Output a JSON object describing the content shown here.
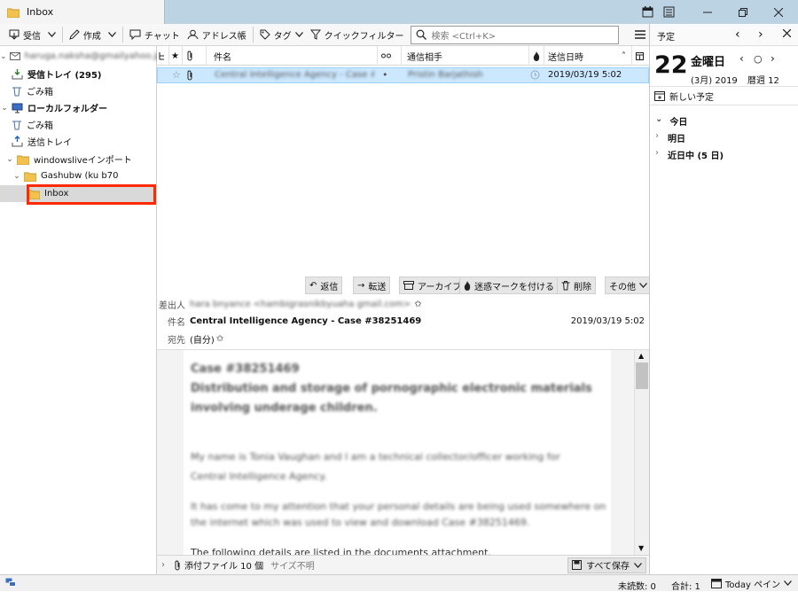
{
  "window": {
    "tab_title": "Inbox"
  },
  "toolbar": {
    "receive": "受信",
    "compose": "作成",
    "chat": "チャット",
    "address_book": "アドレス帳",
    "tag": "タグ",
    "quick_filter": "クイックフィルター",
    "search_placeholder": "検索 <Ctrl+K>"
  },
  "folders": {
    "account_name": "haruga.naksha@gmailyahoo.jp",
    "inbox": "受信トレイ (295)",
    "trash": "ごみ箱",
    "local_folders": "ローカルフォルダー",
    "local_trash": "ごみ箱",
    "outbox": "送信トレイ",
    "windowslive": "windowsliveインポート",
    "gashubw": "Gashubw (ku b70",
    "selected_inbox": "Inbox"
  },
  "message_list": {
    "columns": {
      "subject": "件名",
      "correspondent": "通信相手",
      "date": "送信日時"
    },
    "rows": [
      {
        "subject": "Central Intelligence Agency - Case #38251469",
        "correspondent": "Pristin Barjathish",
        "dot": "•",
        "date": "2019/03/19 5:02"
      }
    ]
  },
  "message_actions": {
    "reply": "返信",
    "forward": "転送",
    "archive": "アーカイブ",
    "junk": "迷惑マークを付ける",
    "delete": "削除",
    "more": "その他"
  },
  "message_header": {
    "from_label": "差出人",
    "from_value": "hara bnyance <hambigrasnikbyuaha gmail.com>",
    "subject_label": "件名",
    "subject_value": "Central Intelligence Agency - Case #38251469",
    "date_value": "2019/03/19 5:02",
    "to_label": "宛先",
    "to_value": "(自分)"
  },
  "message_body": {
    "lines": [
      "Case #38251469",
      "Distribution and storage of pornographic electronic materials",
      "involving underage children.",
      "",
      "My name is Tonia Vaughan and I am a technical collector/officer working for",
      "Central Intelligence Agency.",
      "",
      "It has come to my attention that your personal details are being used somewhere on",
      "the internet which was used to view and download Case #38251469.",
      "",
      "The following details are listed in the documents attachment."
    ]
  },
  "attachments": {
    "label": "添付ファイル 10 個",
    "size": "サイズ不明",
    "save_all": "すべて保存"
  },
  "calendar": {
    "pane_title": "予定",
    "day_number": "22",
    "weekday": "金曜日",
    "month_year": "(3月) 2019",
    "week": "暦週 12",
    "new_event": "新しい予定",
    "sections": [
      "今日",
      "明日",
      "近日中 (5 日)"
    ]
  },
  "status": {
    "unread": "未読数: 0",
    "total": "合計: 1",
    "today_pane": "Today ペイン"
  },
  "colors": {
    "selection": "#cce8ff",
    "highlight_box": "#ff2a00",
    "titlebar": "#bcd3e4"
  }
}
